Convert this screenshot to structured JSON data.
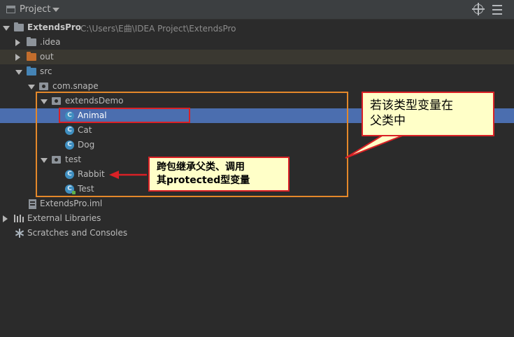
{
  "header": {
    "title": "Project",
    "icons": [
      "project-window-icon",
      "dropdown-arrow-icon",
      "scroll-from-source-icon",
      "collapse-all-icon"
    ]
  },
  "tree": {
    "root": {
      "name": "ExtendsPro",
      "path": "C:\\Users\\E曲\\IDEA Project\\ExtendsPro"
    },
    "idea_folder": ".idea",
    "out_folder": "out",
    "src_folder": "src",
    "package": "com.snape",
    "extends_package": "extendsDemo",
    "classes_extends": [
      "Animal",
      "Cat",
      "Dog"
    ],
    "test_package": "test",
    "classes_test": [
      "Rabbit",
      "Test"
    ],
    "iml_file": "ExtendsPro.iml",
    "external_libraries": "External Libraries",
    "scratches": "Scratches and Consoles",
    "class_badge": "C"
  },
  "annotations": {
    "callout_right": [
      "若该类型变量在",
      "父类中"
    ],
    "callout_center": [
      "跨包继承父类、调用",
      "其protected型变量"
    ]
  },
  "colors": {
    "background": "#2b2b2b",
    "header": "#3c3f41",
    "selection": "#4b6eaf",
    "excluded_row": "#3a3831",
    "class_icon": "#3f8fc1",
    "annotation_orange": "#e4882a",
    "annotation_red": "#d92126",
    "callout_fill": "#ffffc8"
  }
}
